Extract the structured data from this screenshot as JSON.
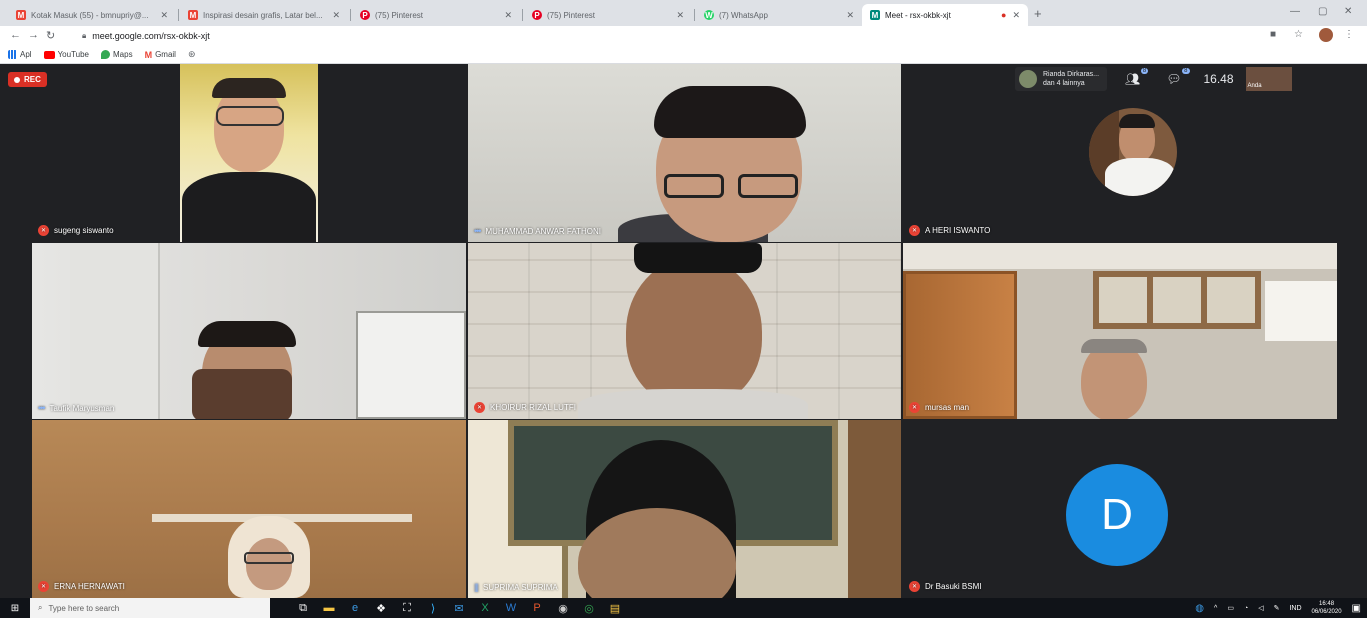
{
  "browser": {
    "tabs": [
      {
        "title": "Kotak Masuk (55) - bmnupriy@...",
        "icon": "gmail-icon",
        "color": "#ea4335",
        "glyph": "M"
      },
      {
        "title": "Inspirasi desain grafis, Latar bel...",
        "icon": "gmail-icon",
        "color": "#ea4335",
        "glyph": "M"
      },
      {
        "title": "(75) Pinterest",
        "icon": "pinterest-icon",
        "color": "#e60023",
        "glyph": "P"
      },
      {
        "title": "(75) Pinterest",
        "icon": "pinterest-icon",
        "color": "#e60023",
        "glyph": "P"
      },
      {
        "title": "(7) WhatsApp",
        "icon": "whatsapp-icon",
        "color": "#25d366",
        "glyph": "W"
      },
      {
        "title": "Meet - rsx-okbk-xjt",
        "icon": "meet-icon",
        "color": "#00897b",
        "glyph": "M",
        "recording": true
      }
    ],
    "url": "meet.google.com/rsx-okbk-xjt",
    "bookmarks": [
      {
        "label": "Apl",
        "icon": "apps-grid-icon",
        "color": "#5f6368"
      },
      {
        "label": "YouTube",
        "icon": "youtube-icon",
        "color": "#ff0000"
      },
      {
        "label": "Maps",
        "icon": "maps-icon",
        "color": "#34a853"
      },
      {
        "label": "Gmail",
        "icon": "gmail-icon",
        "color": "#ea4335"
      }
    ]
  },
  "meet": {
    "rec_label": "REC",
    "participants_chip": {
      "line1": "Rianda Dirkaras...",
      "line2": "dan 4 lainnya"
    },
    "people_count_badge": "8",
    "chat_badge": "8",
    "clock": "16.48",
    "self_view_name": "Anda",
    "tiles": [
      {
        "name": "sugeng siswanto",
        "muted": true
      },
      {
        "name": "MUHAMMAD ANWAR FATHONI",
        "muted": false
      },
      {
        "name": "A HERI ISWANTO",
        "muted": true
      },
      {
        "name": "Taufik Maryusman",
        "muted": false
      },
      {
        "name": "KHOIRUR RIZAL LUTFI",
        "muted": true
      },
      {
        "name": "mursas man",
        "muted": true
      },
      {
        "name": "ERNA HERNAWATI",
        "muted": true
      },
      {
        "name": "SUPRIMA SUPRIMA",
        "muted": false
      },
      {
        "name": "Dr Basuki BSMI",
        "muted": true
      }
    ],
    "avatar_letter": "D",
    "accent": "#1a8ce0"
  },
  "taskbar": {
    "search_placeholder": "Type here to search",
    "lang": "IND",
    "time": "16:48",
    "date": "06/06/2020"
  }
}
